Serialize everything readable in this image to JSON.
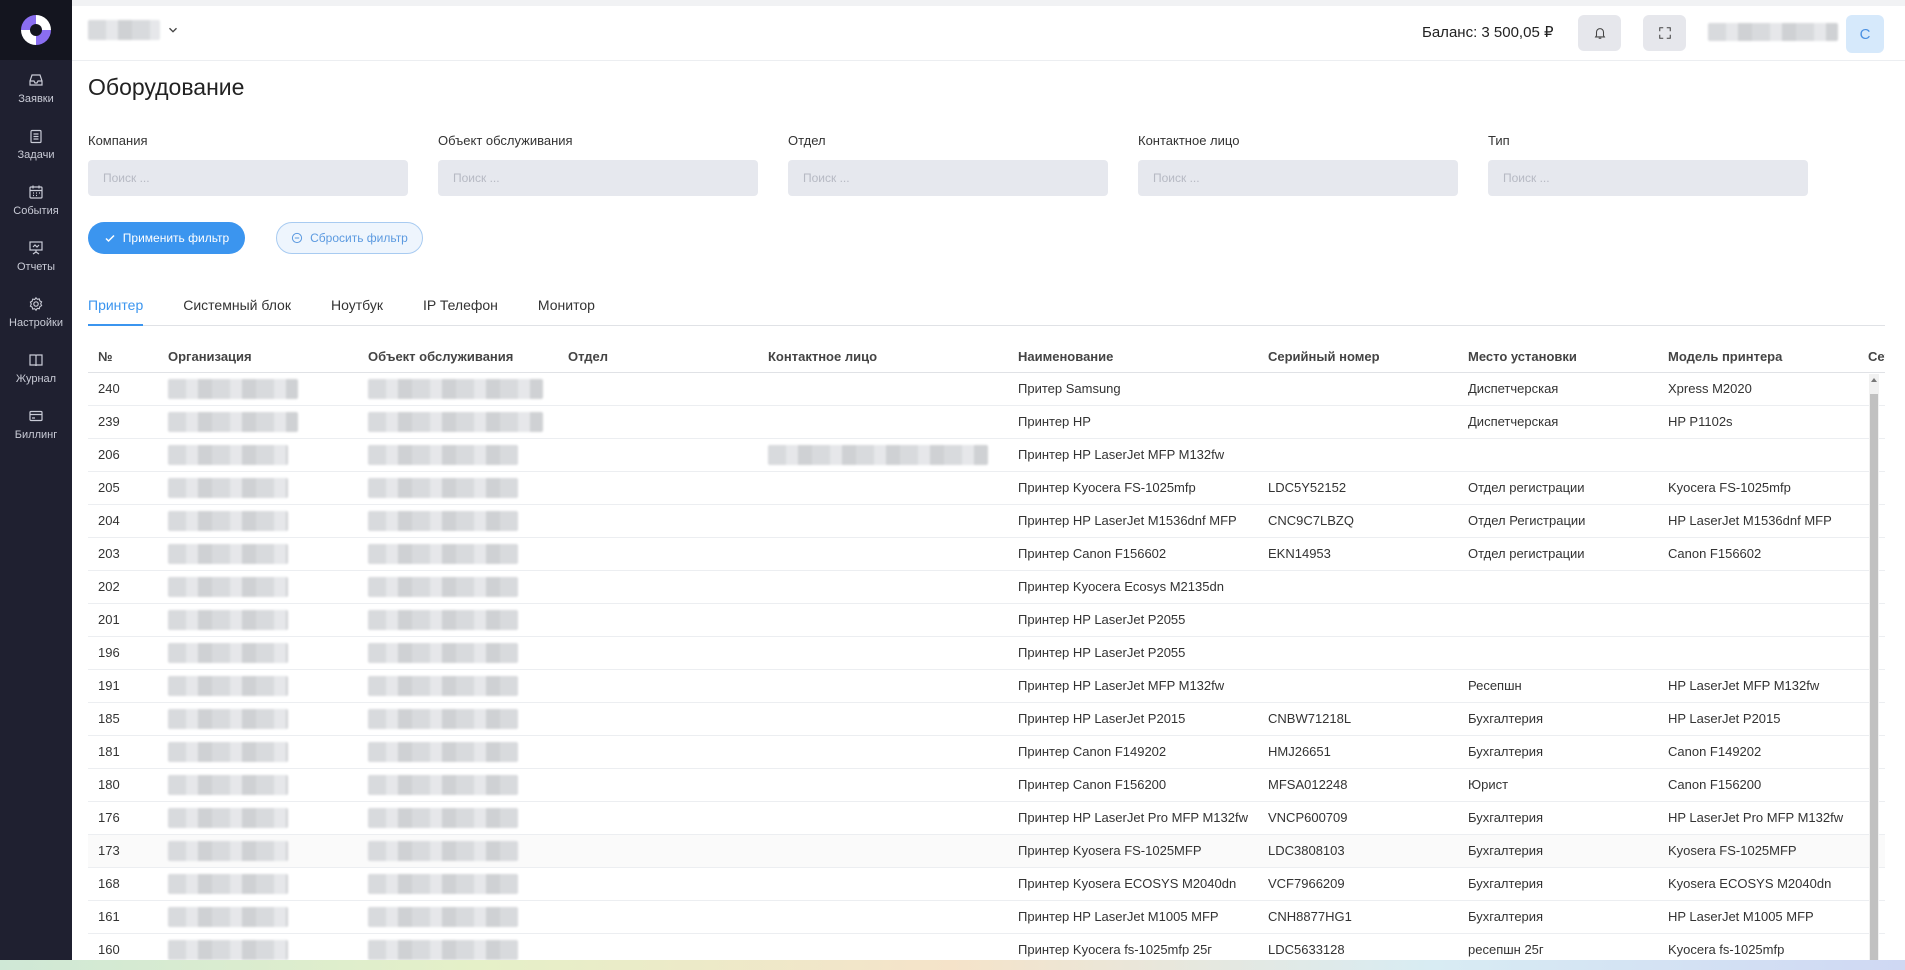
{
  "sidebar": {
    "items": [
      {
        "label": "Заявки",
        "icon": "inbox-icon"
      },
      {
        "label": "Задачи",
        "icon": "clipboard-icon"
      },
      {
        "label": "События",
        "icon": "calendar-icon"
      },
      {
        "label": "Отчеты",
        "icon": "presentation-icon"
      },
      {
        "label": "Настройки",
        "icon": "gear-icon"
      },
      {
        "label": "Журнал",
        "icon": "book-icon"
      },
      {
        "label": "Биллинг",
        "icon": "credit-card-icon"
      }
    ]
  },
  "header": {
    "balance": "Баланс: 3 500,05 ₽",
    "avatar_letter": "C"
  },
  "page": {
    "title": "Оборудование"
  },
  "filters": [
    {
      "label": "Компания",
      "placeholder": "Поиск ..."
    },
    {
      "label": "Объект обслуживания",
      "placeholder": "Поиск ..."
    },
    {
      "label": "Отдел",
      "placeholder": "Поиск ..."
    },
    {
      "label": "Контактное лицо",
      "placeholder": "Поиск ..."
    },
    {
      "label": "Тип",
      "placeholder": "Поиск ..."
    }
  ],
  "buttons": {
    "apply": "Применить фильтр",
    "reset": "Сбросить фильтр"
  },
  "tabs": [
    "Принтер",
    "Системный блок",
    "Ноутбук",
    "IP Телефон",
    "Монитор"
  ],
  "active_tab": "Принтер",
  "colors": {
    "accent": "#3b95ef",
    "sidebar": "#1f2030"
  },
  "table": {
    "columns": [
      "№",
      "Организация",
      "Объект обслуживания",
      "Отдел",
      "Контактное лицо",
      "Наименование",
      "Серийный номер",
      "Место установки",
      "Модель принтера",
      "Сете"
    ],
    "rows": [
      [
        "240",
        "",
        "",
        "",
        "",
        "Притер Samsung",
        "",
        "Диспетчерская",
        "Xpress M2020",
        ""
      ],
      [
        "239",
        "",
        "",
        "",
        "",
        "Принтер HP",
        "",
        "Диспетчерская",
        "HP P1102s",
        ""
      ],
      [
        "206",
        "",
        "",
        "",
        "",
        "Принтер HP LaserJet MFP M132fw",
        "",
        "",
        "",
        ""
      ],
      [
        "205",
        "",
        "",
        "",
        "",
        "Принтер Kyocera FS-1025mfp",
        "LDC5Y52152",
        "Отдел регистрации",
        "Kyocera FS-1025mfp",
        ""
      ],
      [
        "204",
        "",
        "",
        "",
        "",
        "Принтер HP LaserJet M1536dnf MFP",
        "CNC9C7LBZQ",
        "Отдел Регистрации",
        "HP LaserJet M1536dnf MFP",
        ""
      ],
      [
        "203",
        "",
        "",
        "",
        "",
        "Принтер Canon F156602",
        "EKN14953",
        "Отдел регистрации",
        "Canon F156602",
        ""
      ],
      [
        "202",
        "",
        "",
        "",
        "",
        "Принтер Kyocera Ecosys M2135dn",
        "",
        "",
        "",
        ""
      ],
      [
        "201",
        "",
        "",
        "",
        "",
        "Принтер HP LaserJet P2055",
        "",
        "",
        "",
        ""
      ],
      [
        "196",
        "",
        "",
        "",
        "",
        "Принтер HP LaserJet P2055",
        "",
        "",
        "",
        ""
      ],
      [
        "191",
        "",
        "",
        "",
        "",
        "Принтер HP LaserJet MFP M132fw",
        "",
        "Ресепшн",
        "HP LaserJet MFP M132fw",
        ""
      ],
      [
        "185",
        "",
        "",
        "",
        "",
        "Принтер HP LaserJet P2015",
        "CNBW71218L",
        "Бухгалтерия",
        "HP LaserJet P2015",
        ""
      ],
      [
        "181",
        "",
        "",
        "",
        "",
        "Принтер Canon F149202",
        "HMJ26651",
        "Бухгалтерия",
        "Canon F149202",
        ""
      ],
      [
        "180",
        "",
        "",
        "",
        "",
        "Принтер Canon F156200",
        "MFSA012248",
        "Юрист",
        "Canon F156200",
        ""
      ],
      [
        "176",
        "",
        "",
        "",
        "",
        "Принтер HP LaserJet Pro MFP M132fw",
        "VNCP600709",
        "Бухгалтерия",
        "HP LaserJet Pro MFP M132fw",
        ""
      ],
      [
        "173",
        "",
        "",
        "",
        "",
        "Принтер Kyosera FS-1025MFP",
        "LDC3808103",
        "Бухгалтерия",
        "Kyosera FS-1025MFP",
        ""
      ],
      [
        "168",
        "",
        "",
        "",
        "",
        "Принтер Kyosera ECOSYS M2040dn",
        "VCF7966209",
        "Бухгалтерия",
        "Kyosera ECOSYS M2040dn",
        ""
      ],
      [
        "161",
        "",
        "",
        "",
        "",
        "Принтер HP LaserJet M1005 MFP",
        "CNH8877HG1",
        "Бухгалтерия",
        "HP LaserJet M1005 MFP",
        ""
      ],
      [
        "160",
        "",
        "",
        "",
        "",
        "Принтер Kyocera fs-1025mfp 25г",
        "LDC5633128",
        "ресепшн 25г",
        "Kyocera fs-1025mfp",
        ""
      ]
    ]
  }
}
